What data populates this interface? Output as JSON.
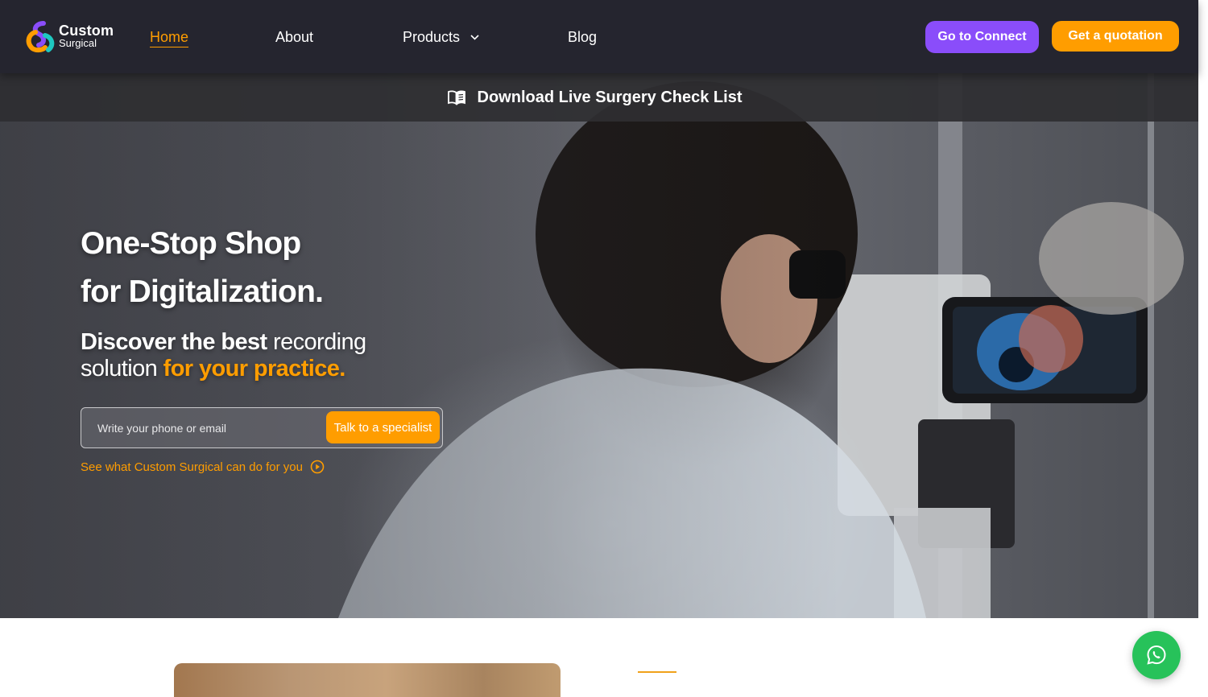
{
  "brand": {
    "name": "Custom",
    "sub": "Surgical",
    "colors": {
      "orange": "#ff9d00",
      "purple": "#8a4dfa",
      "green": "#27c25a",
      "navbar": "#25252f"
    }
  },
  "nav": {
    "items": [
      {
        "label": "Home",
        "active": true
      },
      {
        "label": "About"
      },
      {
        "label": "Products",
        "has_dropdown": true
      },
      {
        "label": "Blog"
      }
    ],
    "connect_label": "Go to Connect",
    "quote_label": "Get a quotation"
  },
  "download_bar": {
    "icon": "open-book-icon",
    "label": "Download Live Surgery Check List"
  },
  "hero": {
    "title_line1": "One-Stop Shop",
    "title_line2": "for Digitalization.",
    "sub_bold": "Discover the best",
    "sub_text1": "recording",
    "sub_text2": "solution",
    "sub_accent": "for your practice.",
    "contact_placeholder": "Write your phone or email",
    "contact_value": "",
    "specialist_label": "Talk to a specialist",
    "see_link": "See what Custom Surgical can do for you",
    "see_icon": "play-circle-icon"
  },
  "floating": {
    "whatsapp_icon": "whatsapp-icon"
  }
}
